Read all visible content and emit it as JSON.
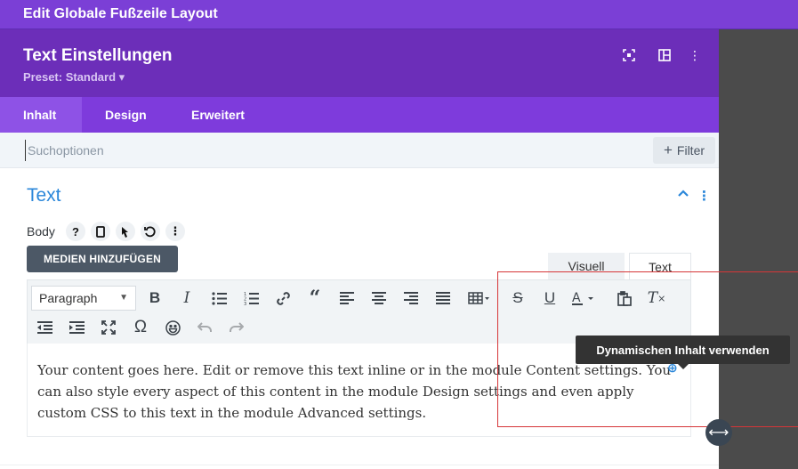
{
  "window": {
    "title": "Edit Globale Fußzeile Layout"
  },
  "header": {
    "title": "Text Einstellungen",
    "preset": "Preset: Standard ▾"
  },
  "header_icons": [
    "focus-icon",
    "layout-icon",
    "more-icon"
  ],
  "tabs": [
    {
      "label": "Inhalt",
      "active": true
    },
    {
      "label": "Design",
      "active": false
    },
    {
      "label": "Erweitert",
      "active": false
    }
  ],
  "search": {
    "placeholder": "Suchoptionen",
    "value": ""
  },
  "filter": {
    "label": "Filter"
  },
  "section": {
    "title": "Text"
  },
  "body_field": {
    "label": "Body"
  },
  "media_button": {
    "label": "MEDIEN HINZUFÜGEN"
  },
  "editor_modes": {
    "visual": "Visuell",
    "text": "Text"
  },
  "toolbar": {
    "format_select": "Paragraph",
    "row1": [
      "bold",
      "italic",
      "bullet-list",
      "numbered-list",
      "link",
      "blockquote",
      "align-left",
      "align-center",
      "align-right",
      "justify",
      "table",
      "strikethrough",
      "underline",
      "text-color",
      "paste-text",
      "clear-formatting"
    ],
    "row2": [
      "outdent",
      "indent",
      "fullscreen",
      "special-character",
      "emoji",
      "undo",
      "redo"
    ]
  },
  "editor": {
    "content": "Your content goes here. Edit or remove this text inline or in the module Content settings. You can also style every aspect of this content in the module Design settings and even apply custom CSS to this text in the module Advanced settings."
  },
  "tooltip": {
    "text": "Dynamischen Inhalt verwenden"
  },
  "colors": {
    "header": "#6c2eb9",
    "tabs": "#7e3bdc",
    "accent": "#2b87da",
    "highlight_box": "#d63638"
  }
}
